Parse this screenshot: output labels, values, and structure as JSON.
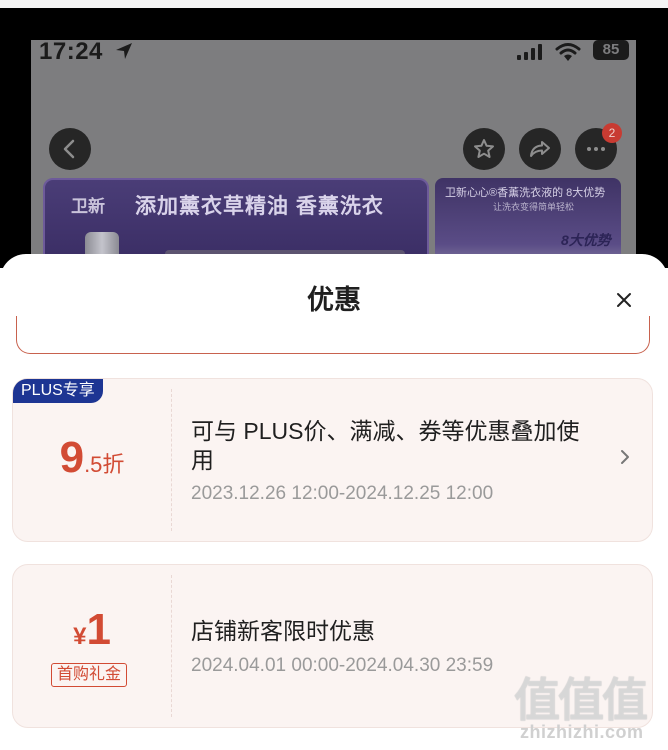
{
  "status_bar": {
    "time": "17:24",
    "battery": "85",
    "icons": [
      "location-arrow-icon",
      "signal-icon",
      "wifi-icon",
      "battery-icon"
    ]
  },
  "product_nav": {
    "notification_count": "2",
    "icons": [
      "back-icon",
      "star-icon",
      "share-icon",
      "more-icon"
    ]
  },
  "banners": {
    "main_brand": "卫新",
    "main_text": "添加薰衣草精油 香薰洗衣",
    "side_title": "卫新心心®香薰洗衣液的 8大优势",
    "side_subtitle": "让洗衣变得简单轻松",
    "side_badge": "8大优势"
  },
  "sheet": {
    "title": "优惠",
    "close_icon": "close-icon"
  },
  "coupons": [
    {
      "tag": "PLUS专享",
      "value_main": "9",
      "value_suffix": ".5折",
      "description": "可与 PLUS价、满减、券等优惠叠加使用",
      "validity": "2023.12.26 12:00-2024.12.25 12:00",
      "has_detail_arrow": true
    },
    {
      "currency": "¥",
      "value_main": "1",
      "tag": "首购礼金",
      "description": "店铺新客限时优惠",
      "validity": "2024.04.01 00:00-2024.04.30 23:59"
    }
  ],
  "watermark": {
    "glyphs": "值值值",
    "url": "zhizhizhi.com"
  },
  "colors": {
    "accent_red": "#d24b34",
    "plus_blue": "#1d3593",
    "card_bg": "#fbf4f2",
    "badge_red": "#c83b32"
  }
}
